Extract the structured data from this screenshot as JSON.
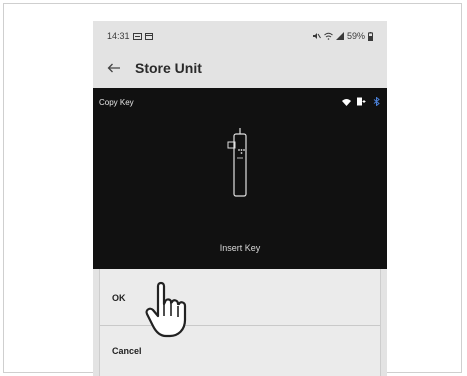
{
  "status_bar": {
    "time": "14:31",
    "battery": "59%"
  },
  "app_bar": {
    "title": "Store Unit"
  },
  "panel": {
    "header": "Copy Key",
    "prompt": "Insert Key"
  },
  "dialog": {
    "ok_label": "OK",
    "cancel_label": "Cancel"
  },
  "icons": {
    "back": "back-arrow-icon",
    "wifi": "wifi-icon",
    "battery": "battery-icon",
    "bluetooth": "bluetooth-icon",
    "key": "key-device-icon",
    "pointer": "hand-pointer-icon"
  },
  "colors": {
    "panel_bg": "#111111",
    "screen_bg": "#e3e3e3",
    "bluetooth": "#4a7fd6"
  }
}
